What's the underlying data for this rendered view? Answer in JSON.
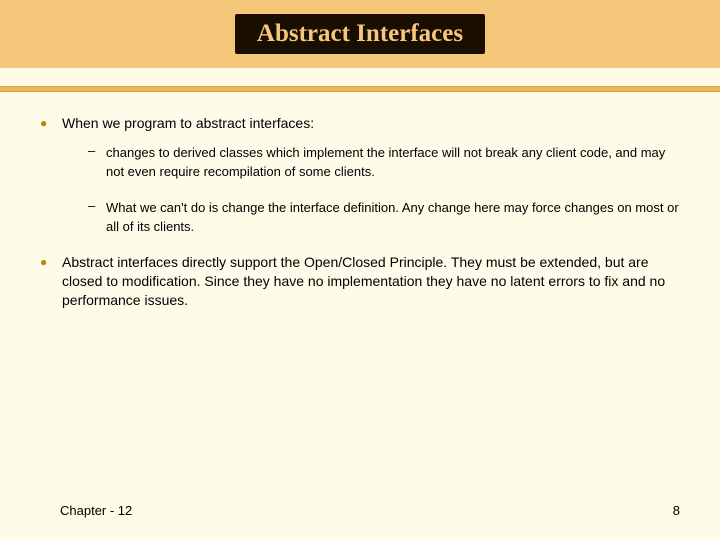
{
  "title": "Abstract Interfaces",
  "bullets": [
    {
      "text": "When we program to abstract interfaces:",
      "subs": [
        "changes to derived classes which implement the interface will not break any client code, and may not even require recompilation of some clients.",
        "What we can't do is change the interface definition.  Any change here may force changes on most or all of its clients."
      ]
    },
    {
      "text": "Abstract interfaces directly support the Open/Closed Principle.  They must be extended, but are closed to modification.  Since they have no implementation they have no latent errors to fix and no performance issues.",
      "subs": []
    }
  ],
  "footer": {
    "left": "Chapter - 12",
    "right": "8"
  }
}
